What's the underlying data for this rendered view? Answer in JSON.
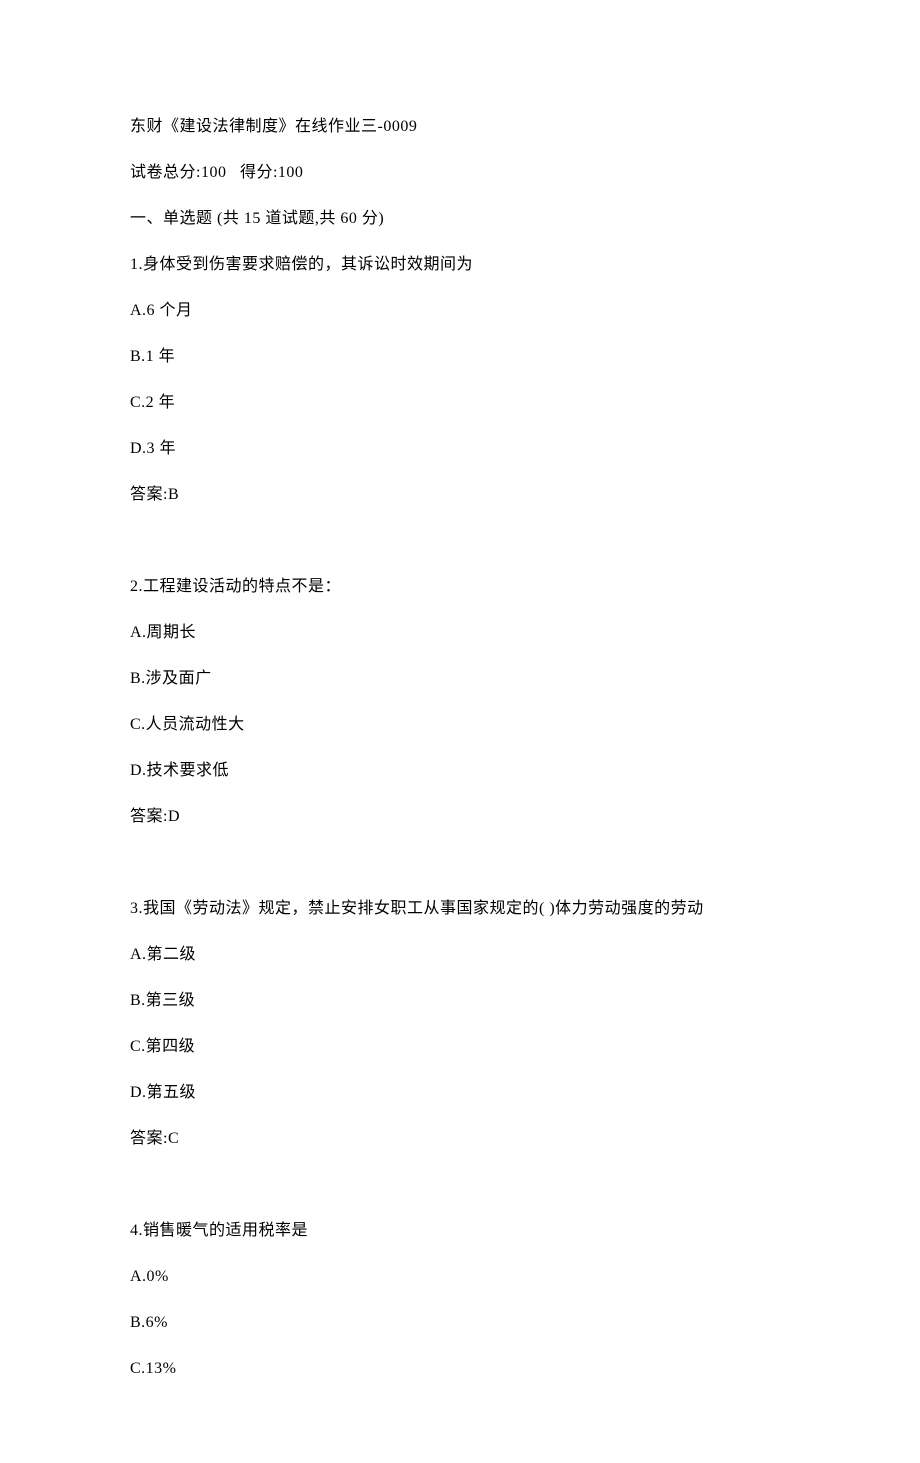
{
  "header": {
    "title": "东财《建设法律制度》在线作业三-0009",
    "score_line": "试卷总分:100   得分:100",
    "section": "一、单选题 (共 15 道试题,共 60 分)"
  },
  "questions": [
    {
      "stem": "1.身体受到伤害要求赔偿的，其诉讼时效期间为",
      "options": [
        "A.6 个月",
        "B.1 年",
        "C.2 年",
        "D.3 年"
      ],
      "answer": "答案:B"
    },
    {
      "stem": "2.工程建设活动的特点不是：",
      "options": [
        "A.周期长",
        "B.涉及面广",
        "C.人员流动性大",
        "D.技术要求低"
      ],
      "answer": "答案:D"
    },
    {
      "stem": "3.我国《劳动法》规定，禁止安排女职工从事国家规定的( )体力劳动强度的劳动",
      "options": [
        "A.第二级",
        "B.第三级",
        "C.第四级",
        "D.第五级"
      ],
      "answer": "答案:C"
    },
    {
      "stem": "4.销售暖气的适用税率是",
      "options": [
        "A.0%",
        "B.6%",
        "C.13%"
      ],
      "answer": ""
    }
  ]
}
